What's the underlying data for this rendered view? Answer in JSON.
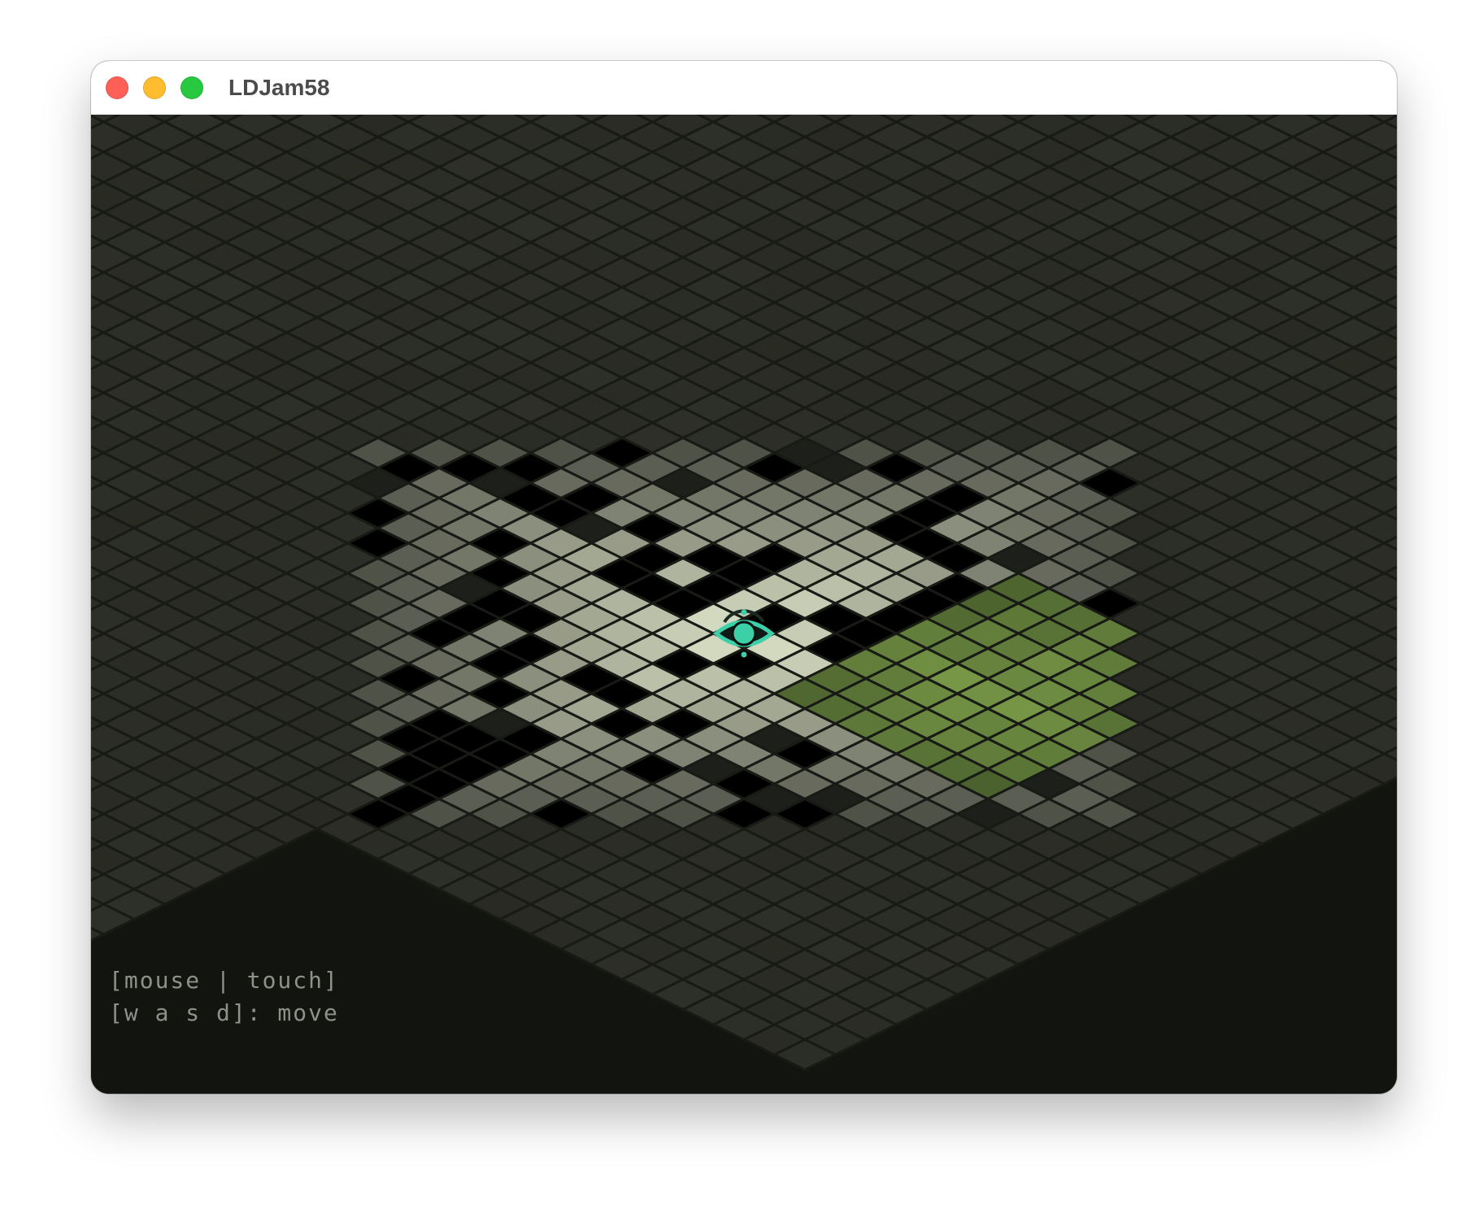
{
  "window": {
    "title": "LDJam58",
    "controls": [
      "close",
      "minimize",
      "zoom"
    ]
  },
  "game": {
    "player_icon": "eye-icon",
    "controls_help": [
      "[mouse | touch]",
      "[w a s d]: move"
    ],
    "colors": {
      "background": "#121410",
      "tile_dark": "#2d2f29",
      "tile_grid_line": "#181a15",
      "tile_lit_max": "#dfe5ca",
      "tile_green": "#7e9f4a",
      "player_accent": "#3ccfa8"
    }
  }
}
